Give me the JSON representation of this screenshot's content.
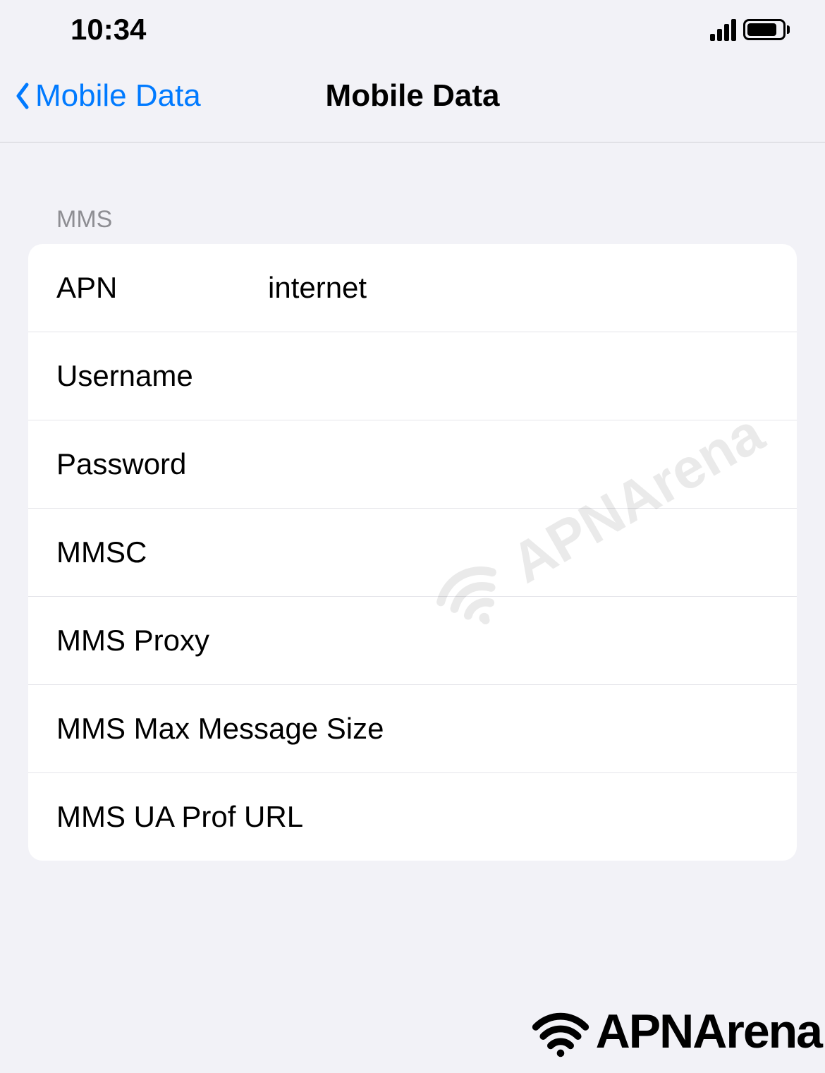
{
  "statusBar": {
    "time": "10:34"
  },
  "navBar": {
    "backLabel": "Mobile Data",
    "title": "Mobile Data"
  },
  "section": {
    "header": "MMS",
    "rows": {
      "apn": {
        "label": "APN",
        "value": "internet"
      },
      "username": {
        "label": "Username",
        "value": ""
      },
      "password": {
        "label": "Password",
        "value": ""
      },
      "mmsc": {
        "label": "MMSC",
        "value": ""
      },
      "mmsProxy": {
        "label": "MMS Proxy",
        "value": ""
      },
      "mmsMaxSize": {
        "label": "MMS Max Message Size",
        "value": ""
      },
      "mmsUaProfUrl": {
        "label": "MMS UA Prof URL",
        "value": ""
      }
    }
  },
  "watermark": {
    "text": "APNArena"
  }
}
